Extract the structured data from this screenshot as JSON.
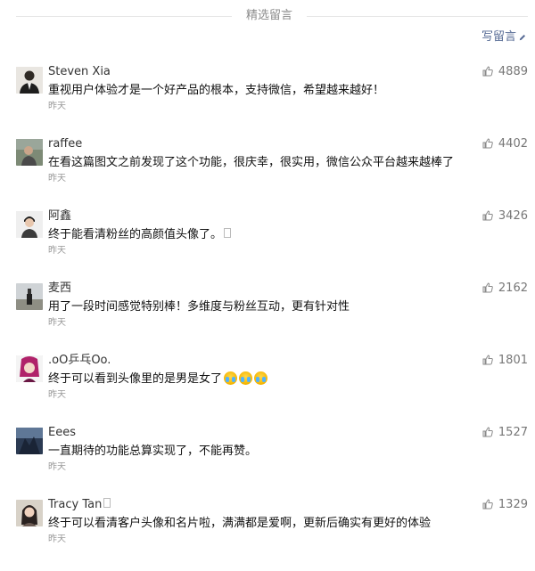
{
  "section_title": "精选留言",
  "write_comment_label": "写留言",
  "comments": [
    {
      "nickname": "Steven Xia",
      "content": "重视用户体验才是一个好产品的根本，支持微信，希望越来越好！",
      "time": "昨天",
      "likes": "4889"
    },
    {
      "nickname": "raffee",
      "content": "在看这篇图文之前发现了这个功能，很庆幸，很实用，微信公众平台越来越棒了",
      "time": "昨天",
      "likes": "4402"
    },
    {
      "nickname": "阿鑫",
      "content": "终于能看清粉丝的高颜值头像了。",
      "time": "昨天",
      "likes": "3426"
    },
    {
      "nickname": "麦西",
      "content": "用了一段时间感觉特别棒！多维度与粉丝互动，更有针对性",
      "time": "昨天",
      "likes": "2162"
    },
    {
      "nickname": ".oO乒乓Oo.",
      "content": "终于可以看到头像里的是男是女了",
      "time": "昨天",
      "likes": "1801"
    },
    {
      "nickname": "Eees",
      "content": "一直期待的功能总算实现了，不能再赞。",
      "time": "昨天",
      "likes": "1527"
    },
    {
      "nickname": "Tracy Tan",
      "content": "终于可以看清客户头像和名片啦，满满都是爱啊，更新后确实有更好的体验",
      "time": "昨天",
      "likes": "1329"
    }
  ]
}
